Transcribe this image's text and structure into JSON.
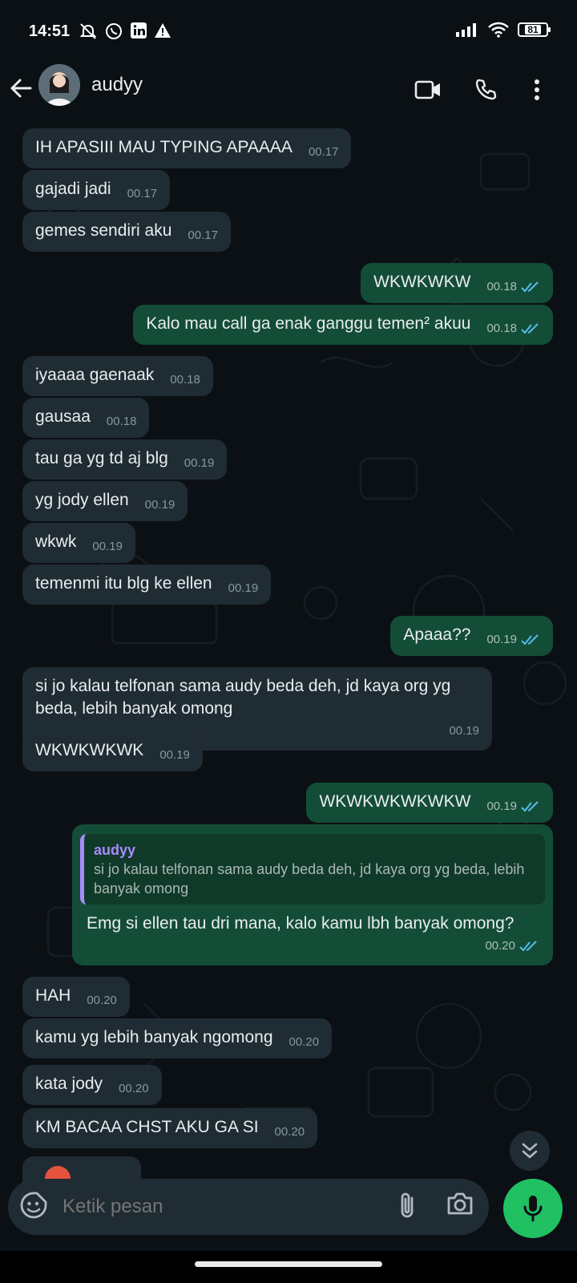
{
  "status_bar": {
    "time": "14:51",
    "battery": "81"
  },
  "header": {
    "contact_name": "audyy"
  },
  "messages": [
    {
      "dir": "in",
      "text": "IH APASIII MAU TYPING APAAAA",
      "time": "00.17"
    },
    {
      "dir": "in",
      "text": "gajadi jadi",
      "time": "00.17"
    },
    {
      "dir": "in",
      "text": "gemes sendiri aku",
      "time": "00.17"
    },
    {
      "dir": "out",
      "text": "WKWKWKW",
      "time": "00.18"
    },
    {
      "dir": "out",
      "text": "Kalo mau call ga enak ganggu temen² akuu",
      "time": "00.18"
    },
    {
      "dir": "in",
      "text": "iyaaaa gaenaak",
      "time": "00.18"
    },
    {
      "dir": "in",
      "text": "gausaa",
      "time": "00.18"
    },
    {
      "dir": "in",
      "text": "tau ga yg td aj blg",
      "time": "00.19"
    },
    {
      "dir": "in",
      "text": "yg jody ellen",
      "time": "00.19"
    },
    {
      "dir": "in",
      "text": "wkwk",
      "time": "00.19"
    },
    {
      "dir": "in",
      "text": "temenmi itu blg ke ellen",
      "time": "00.19"
    },
    {
      "dir": "out",
      "text": "Apaaa??",
      "time": "00.19"
    },
    {
      "dir": "in",
      "text": "si jo kalau telfonan sama audy beda deh, jd kaya org yg beda, lebih banyak omong",
      "time": "00.19"
    },
    {
      "dir": "in",
      "text": "WKWKWKWK",
      "time": "00.19"
    },
    {
      "dir": "out",
      "text": "WKWKWKWKWKW",
      "time": "00.19"
    },
    {
      "dir": "out",
      "text": "Emg si ellen tau dri mana, kalo kamu lbh banyak omong?",
      "time": "00.20",
      "quote": {
        "name": "audyy",
        "text": "si jo kalau telfonan sama audy beda deh, jd kaya org yg beda, lebih banyak omong"
      }
    },
    {
      "dir": "in",
      "text": "HAH",
      "time": "00.20"
    },
    {
      "dir": "in",
      "text": "kamu yg lebih banyak ngomong",
      "time": "00.20"
    },
    {
      "dir": "in",
      "text": "kata jody",
      "time": "00.20"
    },
    {
      "dir": "in",
      "text": "KM BACAA CHST AKU GA SI",
      "time": "00.20"
    }
  ],
  "composer": {
    "placeholder": "Ketik pesan"
  }
}
